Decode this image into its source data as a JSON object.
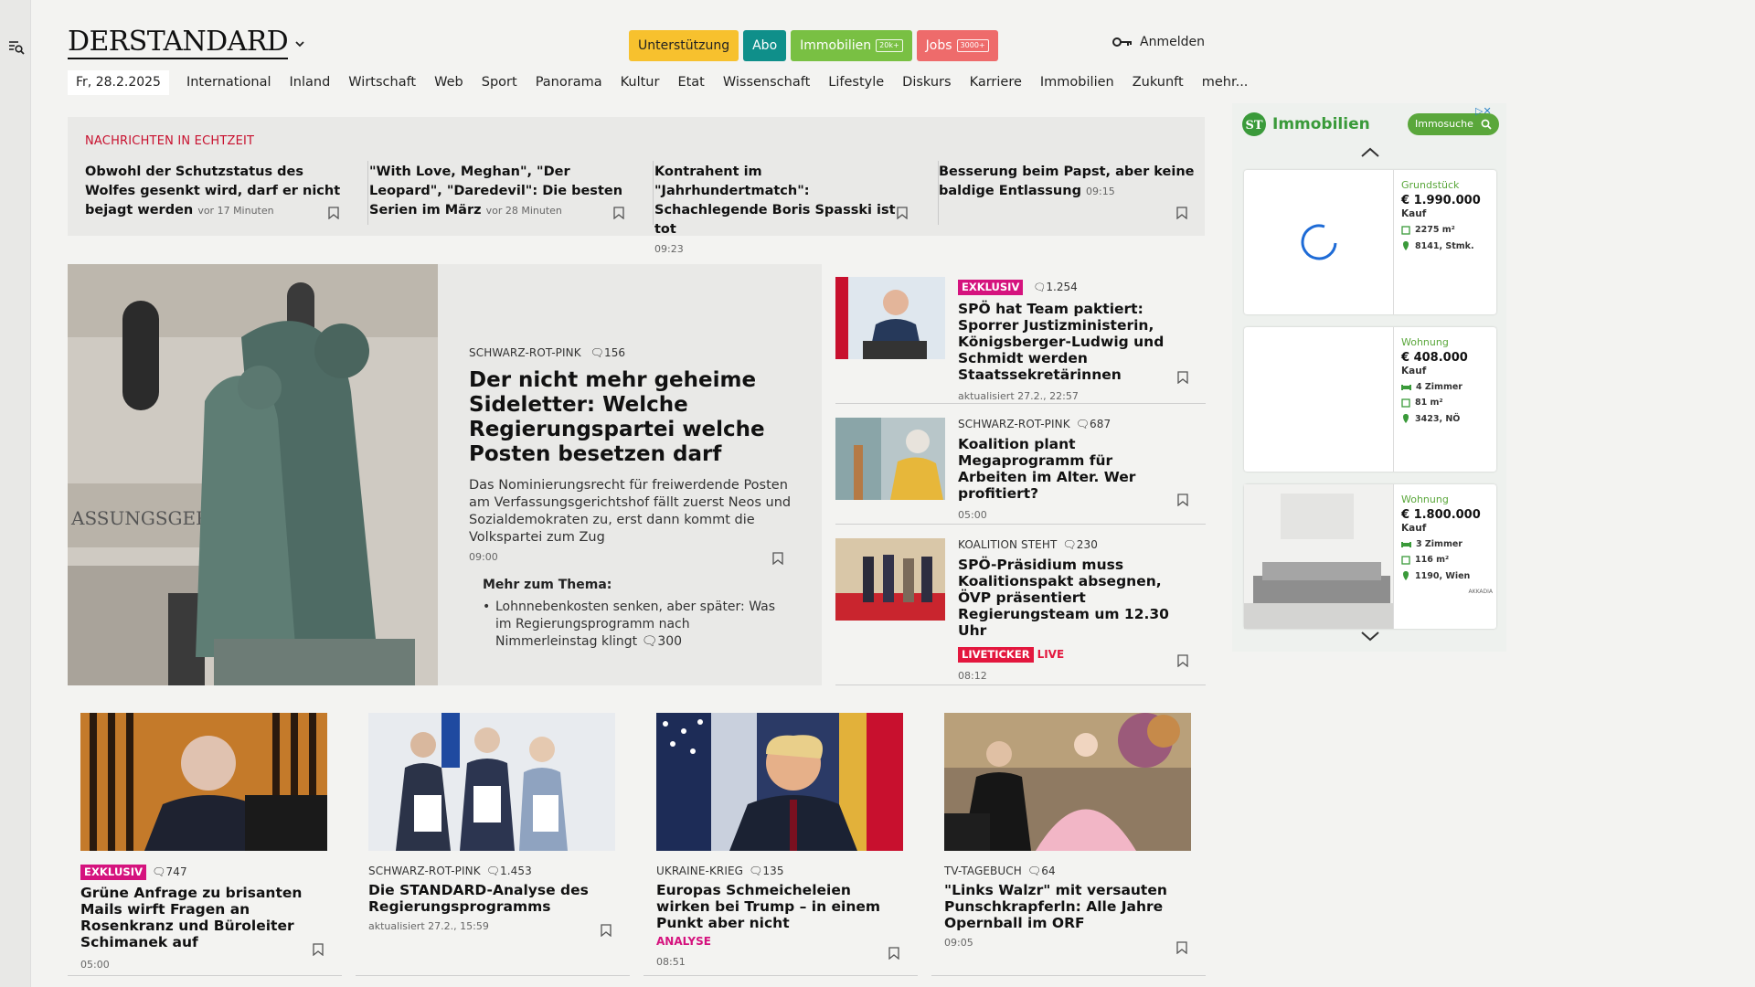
{
  "logo": "DERSTANDARD",
  "header": {
    "pills": [
      {
        "label": "Unterstützung",
        "badge": "",
        "color": "#f7c12e",
        "text": "#222"
      },
      {
        "label": "Abo",
        "badge": "",
        "color": "#0f8f8a",
        "text": "#fff"
      },
      {
        "label": "Immobilien",
        "badge": "20k+",
        "color": "#79c043",
        "text": "#fff"
      },
      {
        "label": "Jobs",
        "badge": "3000+",
        "color": "#ee6b6b",
        "text": "#fff"
      }
    ],
    "login": "Anmelden"
  },
  "nav": {
    "date": "Fr, 28.2.2025",
    "items": [
      "International",
      "Inland",
      "Wirtschaft",
      "Web",
      "Sport",
      "Panorama",
      "Kultur",
      "Etat",
      "Wissenschaft",
      "Lifestyle",
      "Diskurs",
      "Karriere",
      "Immobilien",
      "Zukunft",
      "mehr..."
    ]
  },
  "realtime": {
    "title": "NACHRICHTEN IN ECHTZEIT",
    "items": [
      {
        "text": "Obwohl der Schutzstatus des Wolfes gesenkt wird, darf er nicht bejagt werden",
        "time": "vor 17 Minuten"
      },
      {
        "text": "\"With Love, Meghan\", \"Der Leopard\", \"Daredevil\": Die besten Serien im März",
        "time": "vor 28 Minuten"
      },
      {
        "text": "Kontrahent im \"Jahrhundertmatch\": Schachlegende Boris Spasski ist tot",
        "time": "09:23"
      },
      {
        "text": "Besserung beim Papst, aber keine baldige Entlassung",
        "time": "09:15"
      }
    ]
  },
  "hero": {
    "kicker": "SCHWARZ-ROT-PINK",
    "comments": "156",
    "title": "Der nicht mehr geheime Sideletter: Welche Regierungspartei welche Posten besetzen darf",
    "lead": "Das Nominierungsrecht für freiwerdende Posten am Verfassungsgerichtshof fällt zuerst Neos und Sozialdemokraten zu, erst dann kommt die Volkspartei zum Zug",
    "time": "09:00",
    "more_label": "Mehr zum Thema:",
    "more_item": "Lohnnebenkosten senken, aber später: Was im Regierungsprogramm nach Nimmerleinstag klingt",
    "more_comments": "300"
  },
  "side_articles": [
    {
      "tag": "EXKLUSIV",
      "comments": "1.254",
      "title": "SPÖ hat Team paktiert: Sporrer Justizministerin, Königsberger-Ludwig und Schmidt werden Staatssekretärinnen",
      "time": "aktualisiert 27.2., 22:57"
    },
    {
      "kicker": "SCHWARZ-ROT-PINK",
      "comments": "687",
      "title": "Koalition plant Megaprogramm für Arbeiten im Alter. Wer profitiert?",
      "time": "05:00"
    },
    {
      "kicker": "KOALITION STEHT",
      "comments": "230",
      "title": "SPÖ-Präsidium muss Koalitionspakt absegnen, ÖVP präsentiert Regierungsteam um 12.30 Uhr",
      "tag": "LIVETICKER",
      "live": "LIVE",
      "time": "08:12"
    }
  ],
  "cards": [
    {
      "tag": "EXKLUSIV",
      "comments": "747",
      "title": "Grüne Anfrage zu brisanten Mails wirft Fragen an Rosenkranz und Büroleiter Schimanek auf",
      "time": "05:00"
    },
    {
      "kicker": "SCHWARZ-ROT-PINK",
      "comments": "1.453",
      "title": "Die STANDARD-Analyse des Regierungsprogramms",
      "time": "aktualisiert 27.2., 15:59"
    },
    {
      "kicker": "UKRAINE-KRIEG",
      "comments": "135",
      "title": "Europas Schmeicheleien wirken bei Trump – in einem Punkt aber nicht",
      "sub": "ANALYSE",
      "time": "08:51"
    },
    {
      "kicker": "TV-TAGEBUCH",
      "comments": "64",
      "title": "\"Links Walzr\" mit versauten Punschkrapferln: Alle Jahre Opernball im ORF",
      "time": "09:05"
    }
  ],
  "ad": {
    "brand": "Immobilien",
    "logo_letters": "ST",
    "search": "Immosuche",
    "listings": [
      {
        "type": "Grundstück",
        "price": "€ 1.990.000",
        "kind": "Kauf",
        "rows": [
          "2275 m²",
          "8141, Stmk."
        ]
      },
      {
        "type": "Wohnung",
        "price": "€ 408.000",
        "kind": "Kauf",
        "rows": [
          "4 Zimmer",
          "81 m²",
          "3423, NÖ"
        ]
      },
      {
        "type": "Wohnung",
        "price": "€ 1.800.000",
        "kind": "Kauf",
        "rows": [
          "3 Zimmer",
          "116 m²",
          "1190, Wien"
        ],
        "brand": "AKKADIA"
      }
    ]
  }
}
